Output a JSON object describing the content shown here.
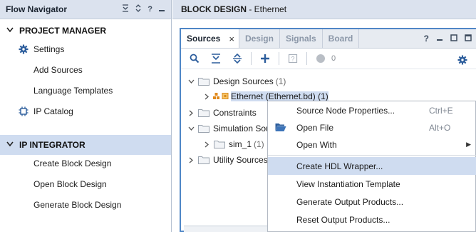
{
  "flow_navigator": {
    "title": "Flow Navigator",
    "header_icons": [
      "collapse-all-icon",
      "expand-all-icon",
      "help-icon",
      "minimize-icon"
    ],
    "help_glyph": "?",
    "project_manager": {
      "label": "PROJECT MANAGER",
      "items": [
        {
          "label": "Settings",
          "icon": "gear-icon"
        },
        {
          "label": "Add Sources"
        },
        {
          "label": "Language Templates"
        },
        {
          "label": "IP Catalog",
          "icon": "ip-catalog-icon"
        }
      ]
    },
    "ip_integrator": {
      "label": "IP INTEGRATOR",
      "items": [
        {
          "label": "Create Block Design"
        },
        {
          "label": "Open Block Design"
        },
        {
          "label": "Generate Block Design"
        }
      ]
    }
  },
  "block_design_header": {
    "prefix": "BLOCK DESIGN",
    "suffix": " - Ethernet"
  },
  "sources_panel": {
    "tabs": [
      {
        "label": "Sources",
        "active": true,
        "close": "×"
      },
      {
        "label": "Design"
      },
      {
        "label": "Signals"
      },
      {
        "label": "Board"
      }
    ],
    "tab_tools": {
      "help": "?"
    },
    "toolbar": {
      "icons": [
        "search-icon",
        "collapse-all-icon",
        "expand-all-icon",
        "add-icon",
        "properties-icon",
        "status-icon"
      ],
      "status_count": "0"
    },
    "tree": [
      {
        "label": "Design Sources",
        "count": "(1)",
        "expanded": true
      },
      {
        "label": "Ethernet (Ethernet.bd) (1)",
        "selected": true
      },
      {
        "label": "Constraints"
      },
      {
        "label": "Simulation Sou"
      },
      {
        "label": "sim_1",
        "count": "(1)"
      },
      {
        "label": "Utility Sources"
      }
    ]
  },
  "context_menu": {
    "items": [
      {
        "label": "Source Node Properties...",
        "shortcut": "Ctrl+E"
      },
      {
        "label": "Open File",
        "shortcut": "Alt+O",
        "icon": "open-folder-icon"
      },
      {
        "label": "Open With",
        "submenu": true,
        "arrow": "▶"
      },
      {
        "label": "Create HDL Wrapper...",
        "highlighted": true
      },
      {
        "label": "View Instantiation Template"
      },
      {
        "label": "Generate Output Products..."
      },
      {
        "label": "Reset Output Products..."
      }
    ]
  },
  "colors": {
    "header_bg": "#dbe2ee",
    "selection_bg": "#cfdcf0",
    "focus_border": "#4f86c6",
    "accent_blue": "#2c5d9c"
  }
}
